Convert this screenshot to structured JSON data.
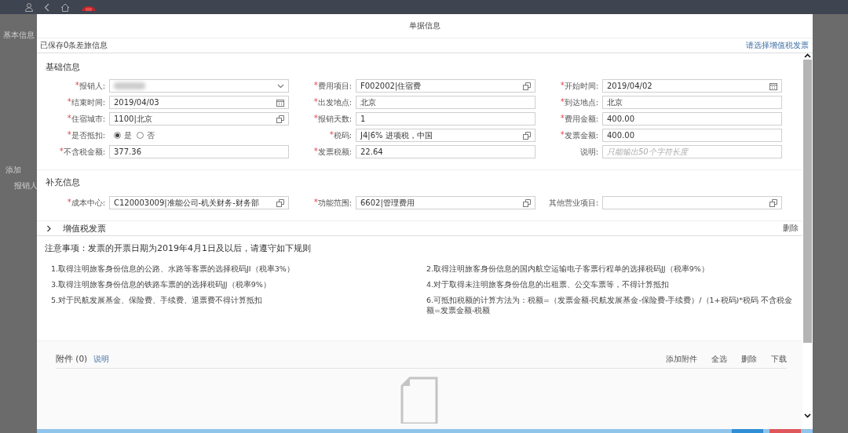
{
  "background": {
    "labels": [
      "基本信息",
      "添加",
      "报销人"
    ]
  },
  "dialog": {
    "title": "单据信息",
    "saved_note": "已保存0条差旅信息",
    "invoice_link": "请选择增值税发票",
    "basic": {
      "title": "基础信息",
      "fields": [
        {
          "mark": "*",
          "label": "报销人:",
          "kind": "select",
          "value_hidden": true
        },
        {
          "mark": "*",
          "label": "费用项目:",
          "kind": "lookup",
          "value": "F002002|住宿费"
        },
        {
          "mark": "*",
          "label": "开始时间:",
          "kind": "date",
          "value": "2019/04/02"
        },
        {
          "mark": "*",
          "label": "结束时间:",
          "kind": "date",
          "value": "2019/04/03"
        },
        {
          "mark": "*",
          "label": "出发地点:",
          "kind": "text",
          "value": "北京"
        },
        {
          "mark": "*",
          "label": "到达地点:",
          "kind": "text",
          "value": "北京"
        },
        {
          "mark": "*",
          "label": "住宿城市:",
          "kind": "lookup",
          "value": "1100|北京"
        },
        {
          "mark": "*",
          "label": "报销天数:",
          "kind": "text",
          "value": "1"
        },
        {
          "mark": "*",
          "label": "费用金额:",
          "kind": "text",
          "value": "400.00"
        },
        {
          "mark": "*",
          "label": "是否抵扣:",
          "kind": "radio",
          "options": [
            {
              "label": "是",
              "selected": true
            },
            {
              "label": "否",
              "selected": false
            }
          ]
        },
        {
          "mark": "*",
          "label": "税码:",
          "kind": "lookup",
          "value": "J4|6% 进项税，中国"
        },
        {
          "mark": "*",
          "label": "发票金额:",
          "kind": "text",
          "value": "400.00"
        },
        {
          "mark": "*",
          "label": "不含税金额:",
          "kind": "text",
          "value": "377.36"
        },
        {
          "mark": "*",
          "label": "发票税额:",
          "kind": "text",
          "value": "22.64"
        },
        {
          "label": "说明:",
          "kind": "text",
          "placeholder": "只能输出50个字符长度"
        }
      ]
    },
    "extra": {
      "title": "补充信息",
      "fields": [
        {
          "mark": "*",
          "label": "成本中心:",
          "kind": "lookup",
          "value": "C120003009|准能公司-机关财务-财务部"
        },
        {
          "mark": "*",
          "label": "功能范围:",
          "kind": "lookup",
          "value": "6602|管理费用"
        },
        {
          "label": "其他营业项目:",
          "kind": "lookup"
        }
      ]
    },
    "vat": {
      "title": "增值税发票",
      "expanded": false,
      "delete": "删除"
    },
    "notes": {
      "title": "注意事项：发票的开票日期为2019年4月1日及以后，请遵守如下规则",
      "items": [
        "1.取得注明旅客身份信息的公路、水路等客票的选择税码JI（税率3%）",
        "2.取得注明旅客身份信息的国内航空运输电子客票行程单的选择税码JJ（税率9%）",
        "3.取得注明旅客身份信息的铁路车票的的选择税码JJ（税率9%）",
        "4.对于取得未注明旅客身份信息的出租票、公交车票等，不得计算抵扣",
        "5.对于民航发展基金、保险费、手续费、退票费不得计算抵扣",
        "6.可抵扣税额的计算方法为：税额=（发票金额-民航发展基金-保险费-手续费）/（1+税码)*税码 不含税金额=发票金额-税额"
      ]
    },
    "attachments": {
      "title": "附件 (0)",
      "help": "说明",
      "actions": [
        "添加附件",
        "全选",
        "删除",
        "下载"
      ]
    }
  }
}
